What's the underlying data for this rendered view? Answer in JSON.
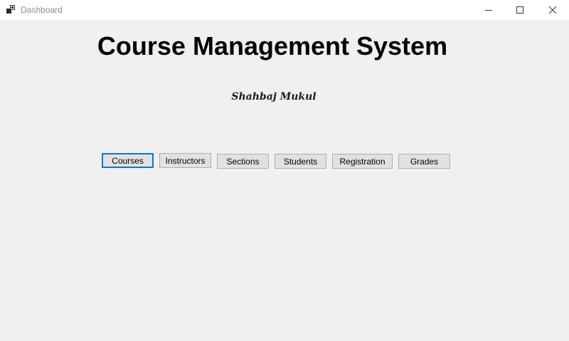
{
  "window": {
    "title": "Dashboard",
    "controls": {
      "minimize_icon": "minimize-icon",
      "maximize_icon": "maximize-icon",
      "close_icon": "close-icon"
    }
  },
  "main": {
    "heading": "Course Management System",
    "author": "Shahbaj Mukul",
    "buttons": [
      {
        "label": "Courses",
        "focused": true
      },
      {
        "label": "Instructors"
      },
      {
        "label": "Sections"
      },
      {
        "label": "Students"
      },
      {
        "label": "Registration"
      },
      {
        "label": "Grades"
      }
    ]
  },
  "colors": {
    "background": "#f0f0f0",
    "button_face": "#e1e1e1",
    "button_border": "#adadad",
    "focus_border": "#0078d7"
  }
}
